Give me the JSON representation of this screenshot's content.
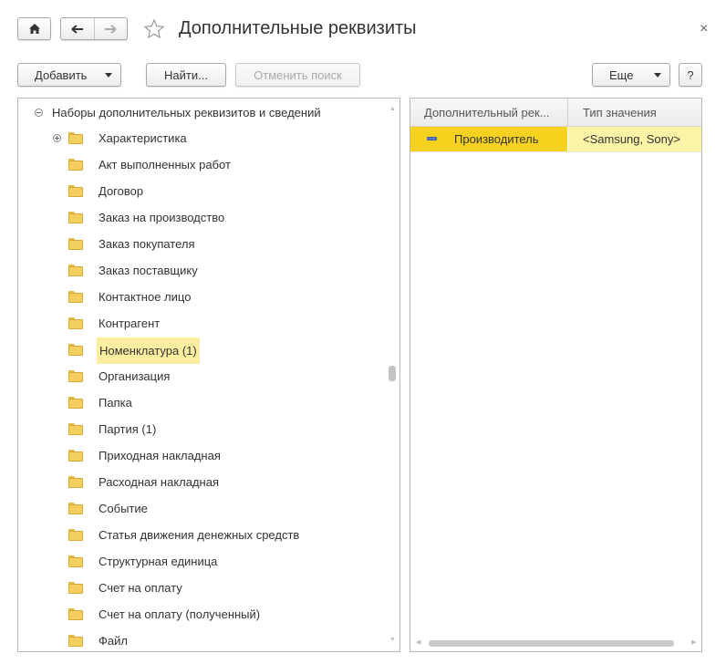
{
  "window": {
    "title": "Дополнительные реквизиты",
    "close_label": "×"
  },
  "toolbar": {
    "add_label": "Добавить",
    "find_label": "Найти...",
    "cancel_search_label": "Отменить поиск",
    "more_label": "Еще",
    "help_label": "?"
  },
  "tree": {
    "root_label": "Наборы дополнительных реквизитов и сведений",
    "items": [
      {
        "label": "Характеристика",
        "expandable": true,
        "selected": false
      },
      {
        "label": "Акт выполненных работ",
        "expandable": false,
        "selected": false
      },
      {
        "label": "Договор",
        "expandable": false,
        "selected": false
      },
      {
        "label": "Заказ на производство",
        "expandable": false,
        "selected": false
      },
      {
        "label": "Заказ покупателя",
        "expandable": false,
        "selected": false
      },
      {
        "label": "Заказ поставщику",
        "expandable": false,
        "selected": false
      },
      {
        "label": "Контактное лицо",
        "expandable": false,
        "selected": false
      },
      {
        "label": "Контрагент",
        "expandable": false,
        "selected": false
      },
      {
        "label": "Номенклатура (1)",
        "expandable": false,
        "selected": true
      },
      {
        "label": "Организация",
        "expandable": false,
        "selected": false
      },
      {
        "label": "Папка",
        "expandable": false,
        "selected": false
      },
      {
        "label": "Партия (1)",
        "expandable": false,
        "selected": false
      },
      {
        "label": "Приходная накладная",
        "expandable": false,
        "selected": false
      },
      {
        "label": "Расходная накладная",
        "expandable": false,
        "selected": false
      },
      {
        "label": "Событие",
        "expandable": false,
        "selected": false
      },
      {
        "label": "Статья движения денежных средств",
        "expandable": false,
        "selected": false
      },
      {
        "label": "Структурная единица",
        "expandable": false,
        "selected": false
      },
      {
        "label": "Счет на оплату",
        "expandable": false,
        "selected": false
      },
      {
        "label": "Счет на оплату (полученный)",
        "expandable": false,
        "selected": false
      },
      {
        "label": "Файл",
        "expandable": false,
        "selected": false
      }
    ]
  },
  "table": {
    "columns": [
      "Дополнительный рек...",
      "Тип значения"
    ],
    "rows": [
      {
        "attribute": "Производитель",
        "value_type": "<Samsung, Sony>"
      }
    ]
  },
  "colors": {
    "selected_cell": "#f6d21e",
    "selected_row": "#fbf3a6",
    "tree_selected": "#fbeea0",
    "folder": "#f3cf60"
  }
}
